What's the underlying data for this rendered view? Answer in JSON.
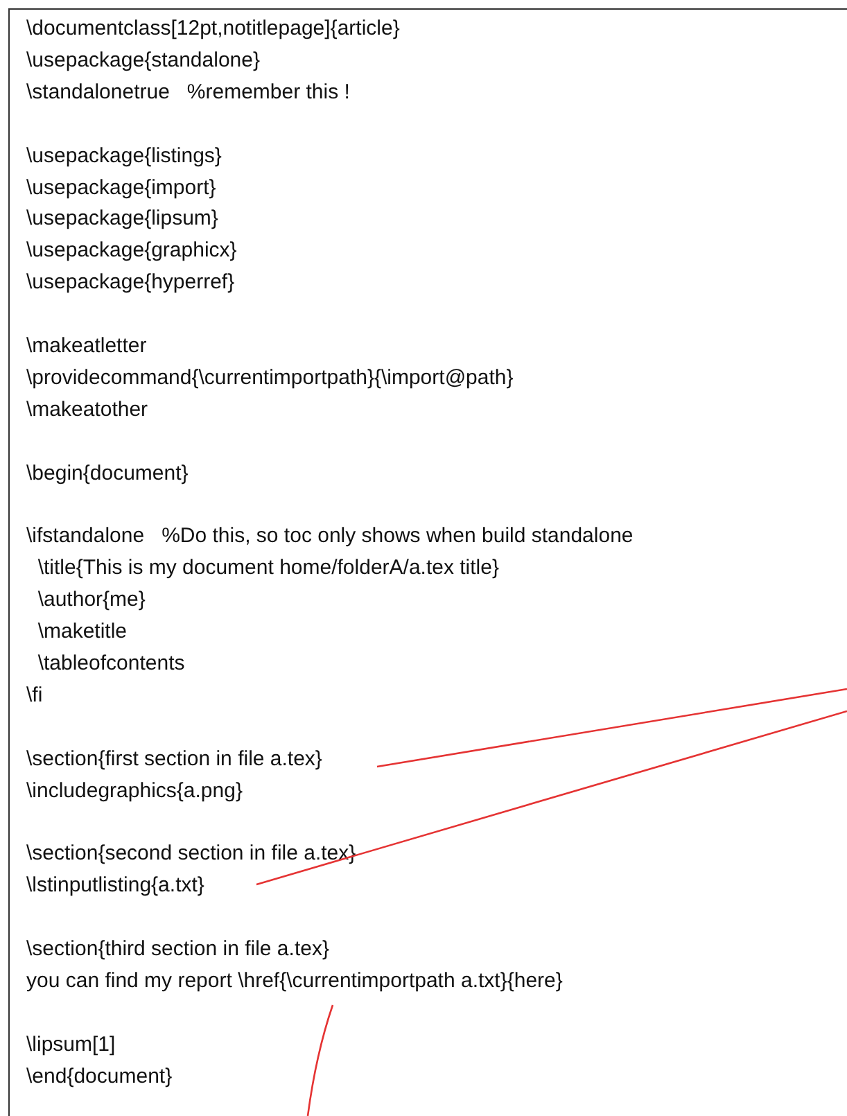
{
  "code_blocks": [
    [
      "\\documentclass[12pt,notitlepage]{article}",
      "\\usepackage{standalone}",
      "\\standalonetrue   %remember this !"
    ],
    [
      "\\usepackage{listings}",
      "\\usepackage{import}",
      "\\usepackage{lipsum}",
      "\\usepackage{graphicx}",
      "\\usepackage{hyperref}"
    ],
    [
      "\\makeatletter",
      "\\providecommand{\\currentimportpath}{\\import@path}",
      "\\makeatother"
    ],
    [
      "\\begin{document}"
    ],
    [
      "\\ifstandalone   %Do this, so toc only shows when build standalone",
      "  \\title{This is my document home/folderA/a.tex title}",
      "  \\author{me}",
      "  \\maketitle",
      "  \\tableofcontents",
      "\\fi"
    ],
    [
      "\\section{first section in file a.tex}",
      "\\includegraphics{a.png}"
    ],
    [
      "\\section{second section in file a.tex}",
      "\\lstinputlisting{a.txt}"
    ],
    [
      "\\section{third section in file a.tex}",
      "you can find my report \\href{\\currentimportpath a.txt}{here}"
    ],
    [
      "\\lipsum[1]",
      "\\end{document}"
    ]
  ]
}
